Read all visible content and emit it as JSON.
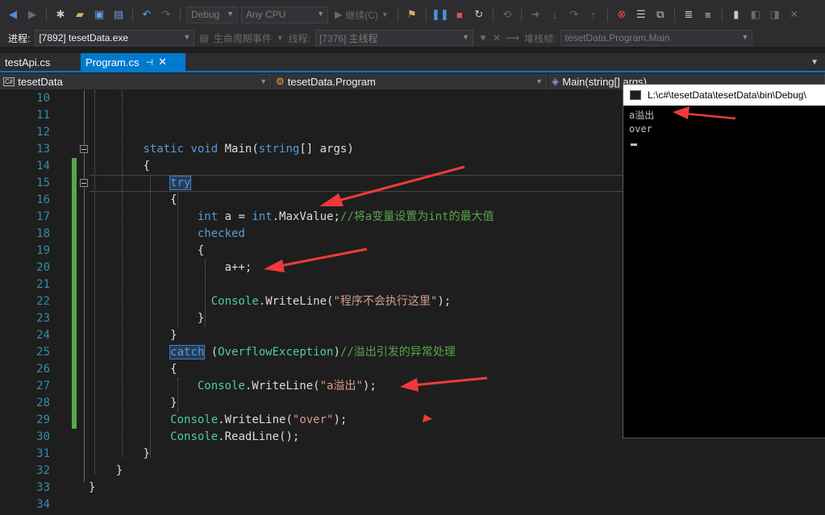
{
  "toolbar": {
    "config_value": "Debug",
    "platform_value": "Any CPU",
    "continue_label": "继续(C)"
  },
  "debugbar": {
    "process_label": "进程:",
    "process_value": "[7892] tesetData.exe",
    "lifecycle_label": "生命周期事件",
    "thread_label": "线程:",
    "thread_value": "[7376] 主线程",
    "stack_label": "堆栈帧:",
    "stack_value": "tesetData.Program.Main"
  },
  "tabs": [
    {
      "label": "testApi.cs"
    },
    {
      "label": "Program.cs",
      "active": true
    }
  ],
  "navbar": {
    "project": "tesetData",
    "class": "tesetData.Program",
    "member": "Main(string[] args)"
  },
  "editor": {
    "line_numbers": [
      "10",
      "11",
      "12",
      "13",
      "14",
      "15",
      "16",
      "17",
      "18",
      "19",
      "20",
      "21",
      "22",
      "23",
      "24",
      "25",
      "26",
      "27",
      "28",
      "29",
      "30",
      "31",
      "32",
      "33",
      "34"
    ],
    "tokens": {
      "static": "static",
      "void": "void",
      "main_sig": " Main(",
      "string": "string",
      "args": "[] args)",
      "open_brace": "{",
      "close_brace": "}",
      "try": "try",
      "int": "int",
      "decl_mid": " a = ",
      "int2": "int",
      "maxvalue": ".MaxValue;",
      "comment1": "//将a变量设置为int的最大值",
      "checked": "checked",
      "increment": "a++;",
      "console": "Console",
      "writeline_open": ".WriteLine(",
      "str_not_executed": "\"程序不会执行这里\"",
      "close_call": ");",
      "catch": "catch",
      "paren_open": " (",
      "overflow_type": "OverflowException",
      "paren_close": ")",
      "comment2": "//溢出引发的异常处理",
      "str_overflow": "\"a溢出\"",
      "str_over": "\"over\"",
      "readline": ".ReadLine();"
    }
  },
  "console": {
    "title": "L:\\c#\\tesetData\\tesetData\\bin\\Debug\\",
    "output_line1": "a溢出",
    "output_line2": "over"
  }
}
